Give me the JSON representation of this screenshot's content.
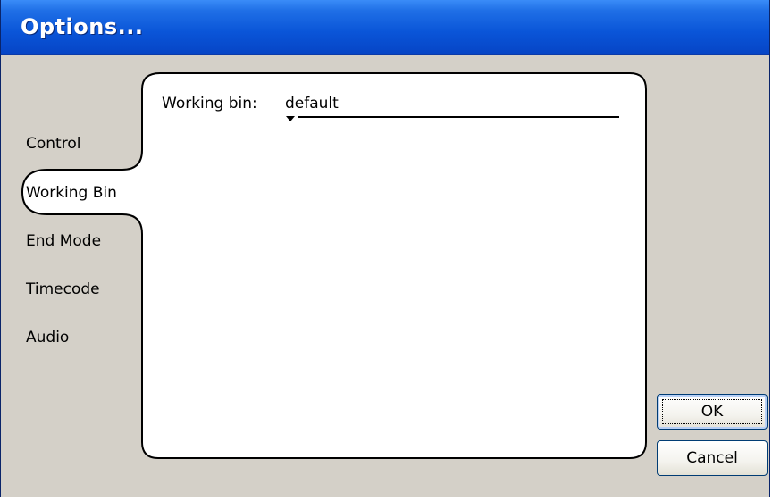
{
  "window": {
    "title": "Options..."
  },
  "tabs": [
    {
      "label": "Control",
      "selected": false
    },
    {
      "label": "Working Bin",
      "selected": true
    },
    {
      "label": "End Mode",
      "selected": false
    },
    {
      "label": "Timecode",
      "selected": false
    },
    {
      "label": "Audio",
      "selected": false
    }
  ],
  "working_bin": {
    "label": "Working bin:",
    "value": "default"
  },
  "buttons": {
    "ok": "OK",
    "cancel": "Cancel"
  },
  "colors": {
    "titlebar": "#0a55d8",
    "dialog_bg": "#d4d0c8",
    "panel_bg": "#ffffff"
  }
}
